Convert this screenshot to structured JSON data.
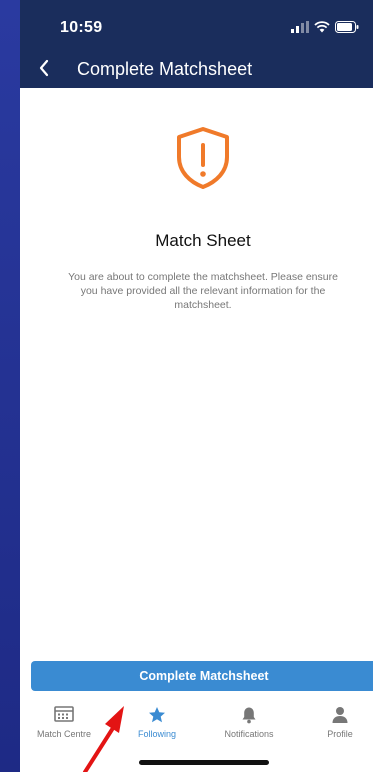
{
  "status_bar": {
    "time": "10:59"
  },
  "nav": {
    "title": "Complete Matchsheet"
  },
  "content": {
    "title": "Match Sheet",
    "description": "You are about to complete the matchsheet. Please ensure you have provided all the relevant information for the matchsheet."
  },
  "button": {
    "label": "Complete Matchsheet"
  },
  "tabs": [
    {
      "label": "Match Centre",
      "icon": "calendar-icon",
      "active": false
    },
    {
      "label": "Following",
      "icon": "star-icon",
      "active": true
    },
    {
      "label": "Notifications",
      "icon": "bell-icon",
      "active": false
    },
    {
      "label": "Profile",
      "icon": "person-icon",
      "active": false
    }
  ],
  "colors": {
    "header": "#1a2d5c",
    "accent": "#3a8bd2",
    "warning": "#f07a2a",
    "annotation": "#e31414"
  }
}
